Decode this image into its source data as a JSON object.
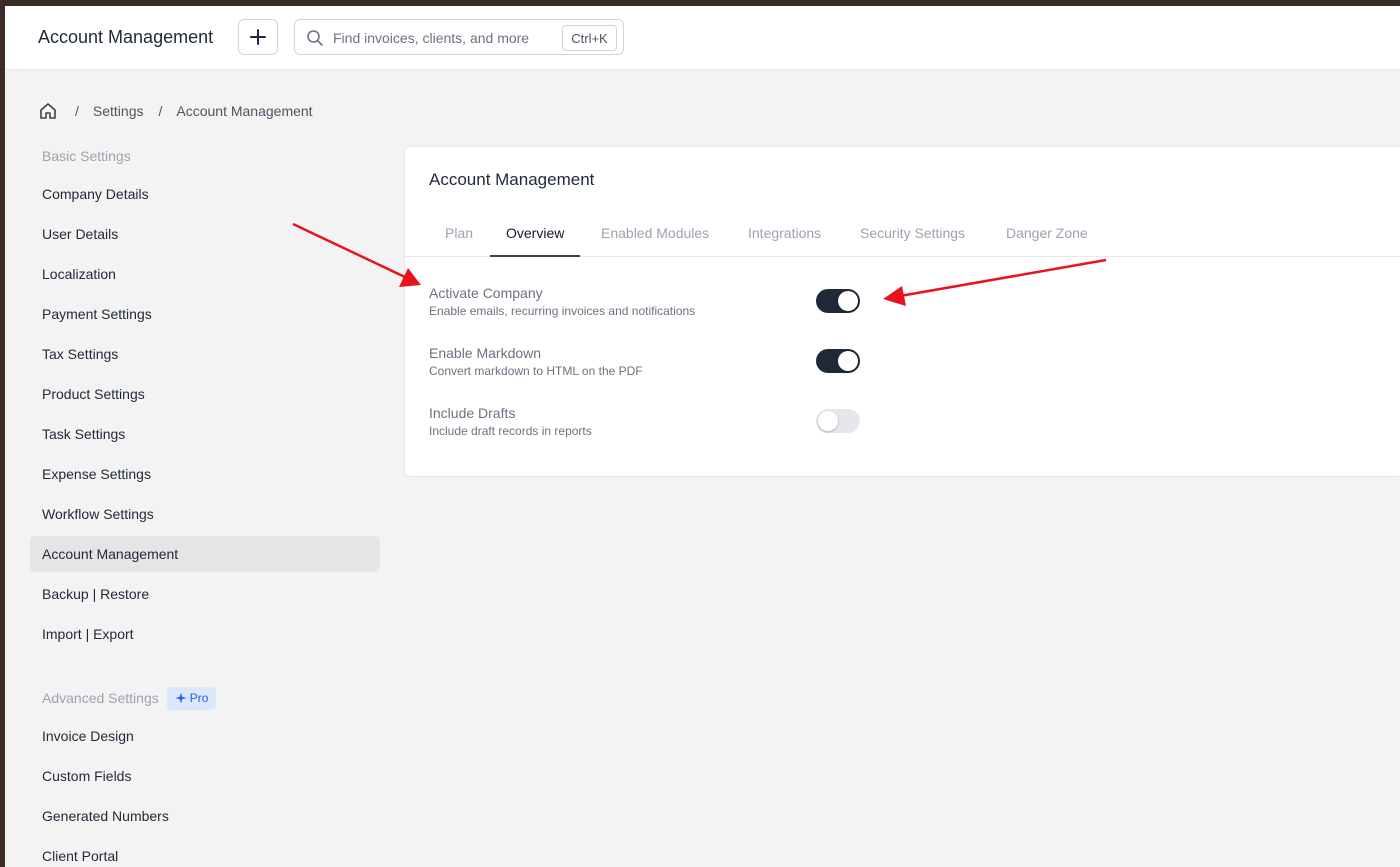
{
  "header": {
    "title": "Account Management",
    "search_placeholder": "Find invoices, clients, and more",
    "shortcut": "Ctrl+K"
  },
  "breadcrumb": {
    "items": [
      "Settings",
      "Account Management"
    ],
    "separator": "/"
  },
  "sidebar": {
    "basic_group": "Basic Settings",
    "basic_items": [
      {
        "label": "Company Details"
      },
      {
        "label": "User Details"
      },
      {
        "label": "Localization"
      },
      {
        "label": "Payment Settings"
      },
      {
        "label": "Tax Settings"
      },
      {
        "label": "Product Settings"
      },
      {
        "label": "Task Settings"
      },
      {
        "label": "Expense Settings"
      },
      {
        "label": "Workflow Settings"
      },
      {
        "label": "Account Management"
      },
      {
        "label": "Backup | Restore"
      },
      {
        "label": "Import | Export"
      }
    ],
    "active_item": "Account Management",
    "advanced_group": "Advanced Settings",
    "pro_badge": "Pro",
    "advanced_items": [
      {
        "label": "Invoice Design"
      },
      {
        "label": "Custom Fields"
      },
      {
        "label": "Generated Numbers"
      },
      {
        "label": "Client Portal"
      }
    ]
  },
  "card": {
    "title": "Account Management",
    "tabs": [
      {
        "label": "Plan"
      },
      {
        "label": "Overview"
      },
      {
        "label": "Enabled Modules"
      },
      {
        "label": "Integrations"
      },
      {
        "label": "Security Settings"
      },
      {
        "label": "Danger Zone"
      }
    ],
    "active_tab": "Overview",
    "settings": [
      {
        "title": "Activate Company",
        "description": "Enable emails, recurring invoices and notifications",
        "enabled": true
      },
      {
        "title": "Enable Markdown",
        "description": "Convert markdown to HTML on the PDF",
        "enabled": true
      },
      {
        "title": "Include Drafts",
        "description": "Include draft records in reports",
        "enabled": false
      }
    ]
  },
  "colors": {
    "toggle_on": "#1f2937",
    "toggle_off": "#e5e7eb",
    "annotation_arrow": "#e8131f",
    "pro_badge_bg": "#dbe7fb",
    "pro_badge_text": "#2563eb"
  },
  "icons": [
    "plus-icon",
    "search-icon",
    "home-icon",
    "sparkle-icon"
  ]
}
